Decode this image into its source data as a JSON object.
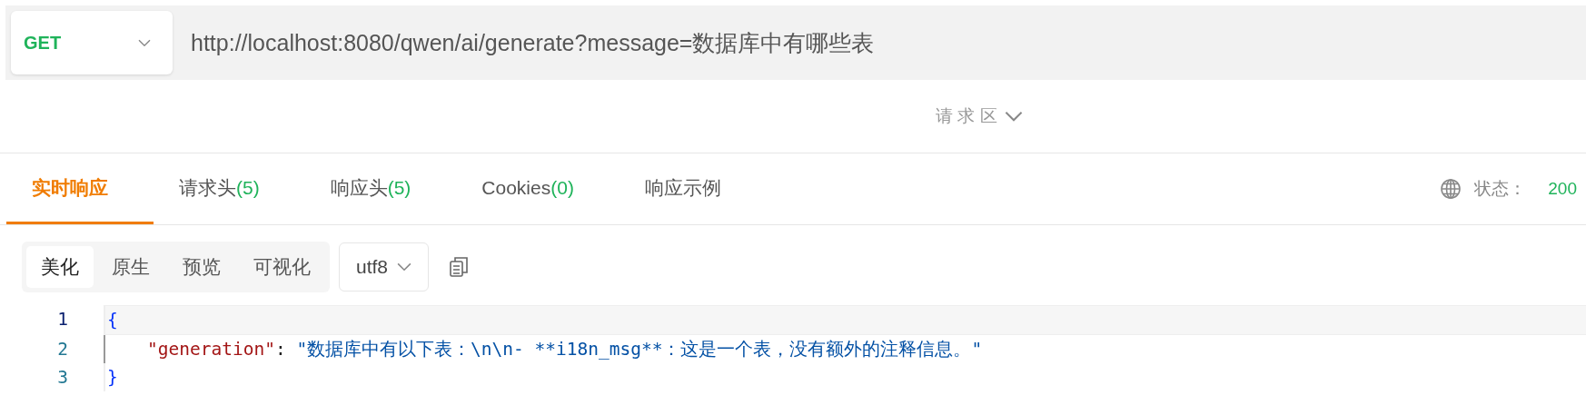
{
  "request": {
    "method": "GET",
    "url": "http://localhost:8080/qwen/ai/generate?message=数据库中有哪些表"
  },
  "request_area_toggle": {
    "label": "请 求 区"
  },
  "tabs": [
    {
      "label": "实时响应",
      "selected": true
    },
    {
      "label": "请求头",
      "count": "(5)",
      "selected": false
    },
    {
      "label": "响应头",
      "count": "(5)",
      "selected": false
    },
    {
      "label": "Cookies",
      "count": "(0)",
      "selected": false
    },
    {
      "label": "响应示例",
      "selected": false
    }
  ],
  "status": {
    "label": "状态：",
    "code": "200"
  },
  "view_modes": [
    {
      "label": "美化",
      "selected": true
    },
    {
      "label": "原生",
      "selected": false
    },
    {
      "label": "预览",
      "selected": false
    },
    {
      "label": "可视化",
      "selected": false
    }
  ],
  "encoding": "utf8",
  "code_lines": [
    {
      "number": "1",
      "current": true,
      "tokens": [
        {
          "kind": "brace",
          "text": "{"
        }
      ]
    },
    {
      "number": "2",
      "current": false,
      "tokens": [
        {
          "kind": "key",
          "text": "\"generation\""
        },
        {
          "kind": "punct",
          "text": ": "
        },
        {
          "kind": "string",
          "text": "\"数据库中有以下表：\\n\\n- **i18n_msg**：这是一个表，没有额外的注释信息。\""
        }
      ]
    },
    {
      "number": "3",
      "current": false,
      "tokens": [
        {
          "kind": "brace",
          "text": "}"
        }
      ]
    }
  ]
}
